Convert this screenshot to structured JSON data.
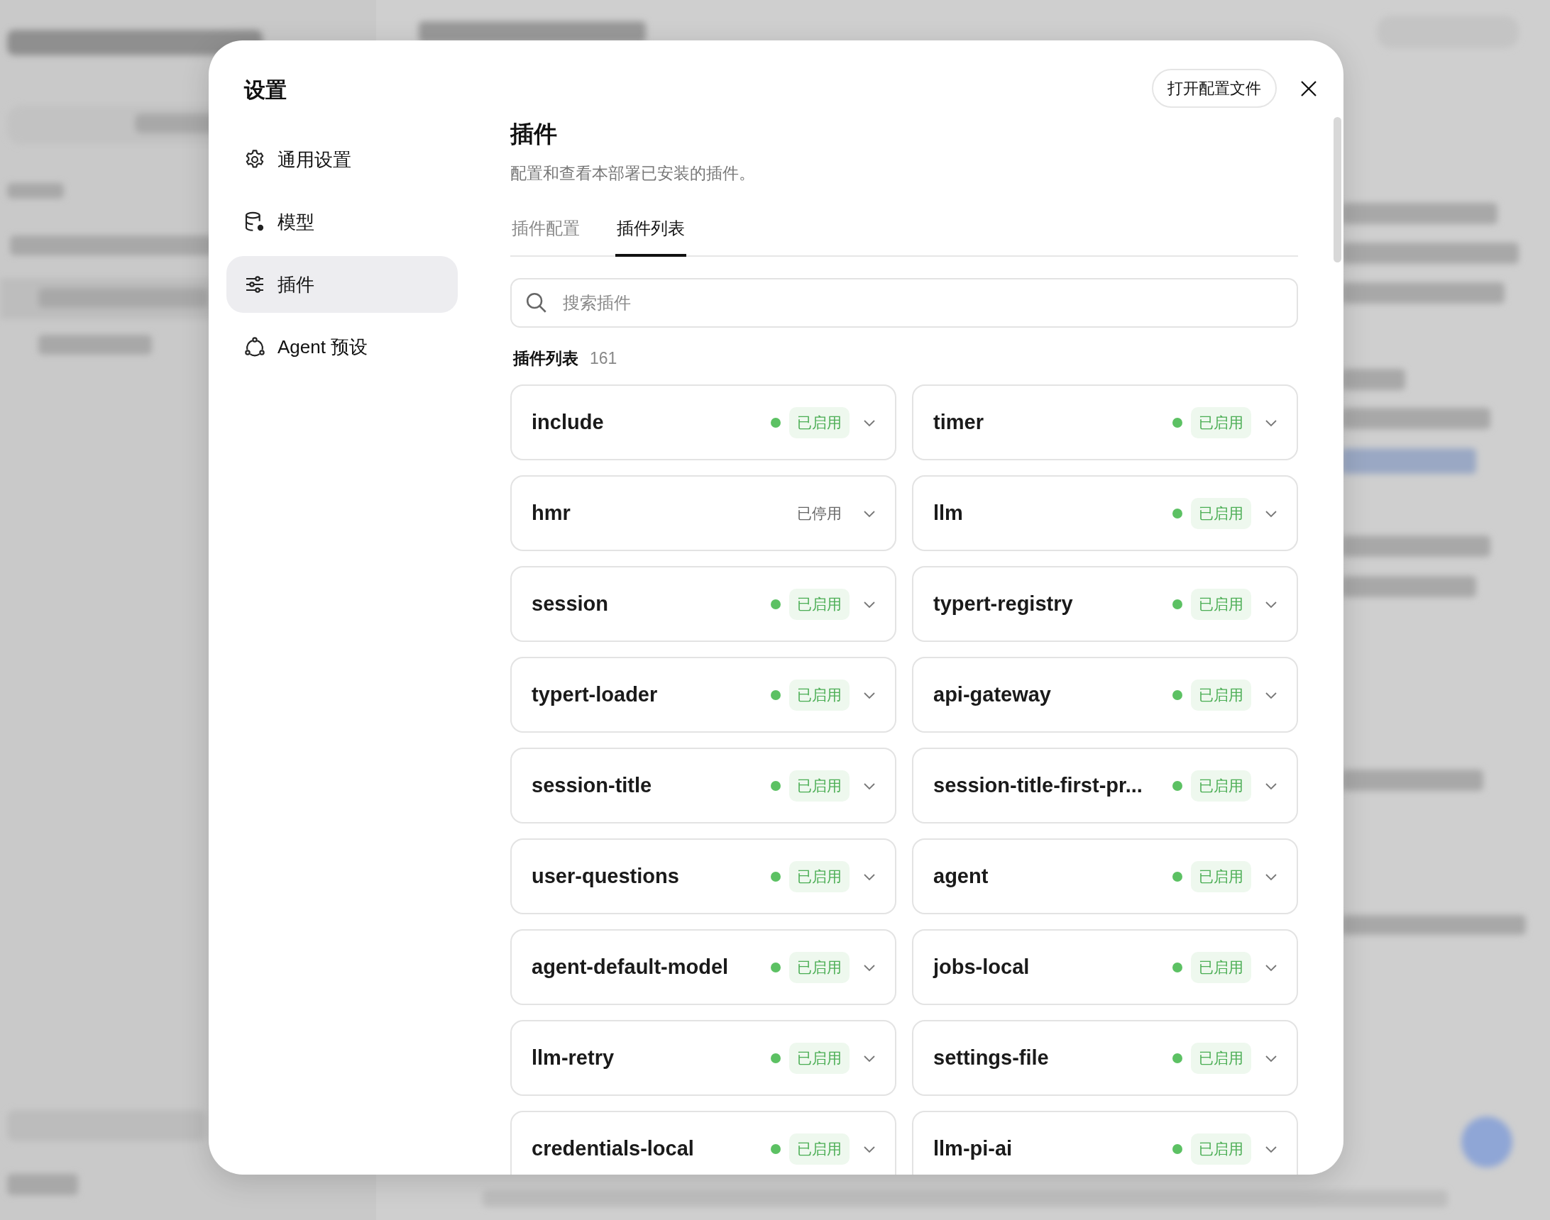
{
  "dialog": {
    "title": "设置",
    "open_config_button": "打开配置文件"
  },
  "sidebar": {
    "items": [
      {
        "label": "通用设置",
        "selected": false
      },
      {
        "label": "模型",
        "selected": false
      },
      {
        "label": "插件",
        "selected": true
      },
      {
        "label": "Agent 预设",
        "selected": false
      }
    ]
  },
  "page": {
    "title": "插件",
    "description": "配置和查看本部署已安装的插件。"
  },
  "tabs": [
    {
      "label": "插件配置",
      "selected": false
    },
    {
      "label": "插件列表",
      "selected": true
    }
  ],
  "search": {
    "placeholder": "搜索插件"
  },
  "list": {
    "title": "插件列表",
    "count": "161"
  },
  "plugins": [
    {
      "name": "include",
      "enabled": true,
      "status": "已启用"
    },
    {
      "name": "timer",
      "enabled": true,
      "status": "已启用"
    },
    {
      "name": "hmr",
      "enabled": false,
      "status": "已停用"
    },
    {
      "name": "llm",
      "enabled": true,
      "status": "已启用"
    },
    {
      "name": "session",
      "enabled": true,
      "status": "已启用"
    },
    {
      "name": "typert-registry",
      "enabled": true,
      "status": "已启用"
    },
    {
      "name": "typert-loader",
      "enabled": true,
      "status": "已启用"
    },
    {
      "name": "api-gateway",
      "enabled": true,
      "status": "已启用"
    },
    {
      "name": "session-title",
      "enabled": true,
      "status": "已启用"
    },
    {
      "name": "session-title-first-pr...",
      "enabled": true,
      "status": "已启用"
    },
    {
      "name": "user-questions",
      "enabled": true,
      "status": "已启用"
    },
    {
      "name": "agent",
      "enabled": true,
      "status": "已启用"
    },
    {
      "name": "agent-default-model",
      "enabled": true,
      "status": "已启用"
    },
    {
      "name": "jobs-local",
      "enabled": true,
      "status": "已启用"
    },
    {
      "name": "llm-retry",
      "enabled": true,
      "status": "已启用"
    },
    {
      "name": "settings-file",
      "enabled": true,
      "status": "已启用"
    },
    {
      "name": "credentials-local",
      "enabled": true,
      "status": "已启用"
    },
    {
      "name": "llm-pi-ai",
      "enabled": true,
      "status": "已启用"
    }
  ]
}
